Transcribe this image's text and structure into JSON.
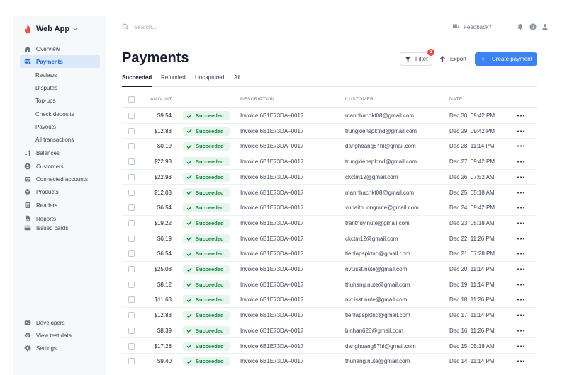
{
  "app": {
    "name": "Web App"
  },
  "sidebar": {
    "top_items": [
      {
        "label": "Overview",
        "icon": "home-icon"
      },
      {
        "label": "Payments",
        "icon": "payments-icon",
        "active": true
      }
    ],
    "sub_items": [
      "Reviews",
      "Disputes",
      "Top-ups",
      "Check deposits",
      "Payouts",
      "All transactions"
    ],
    "items": [
      {
        "label": "Balances",
        "icon": "balances-icon"
      },
      {
        "label": "Customers",
        "icon": "customers-icon"
      },
      {
        "label": "Connected accounts",
        "icon": "connected-accounts-icon"
      },
      {
        "label": "Products",
        "icon": "products-icon"
      },
      {
        "label": "Readers",
        "icon": "readers-icon"
      },
      {
        "label": "Reports",
        "icon": "reports-icon"
      },
      {
        "label": "Issued cards",
        "icon": "issued-cards-icon"
      }
    ],
    "bottom_items": [
      {
        "label": "Developers",
        "icon": "developers-icon"
      },
      {
        "label": "View test data",
        "icon": "eye-icon"
      },
      {
        "label": "Settings",
        "icon": "gear-icon"
      }
    ]
  },
  "topbar": {
    "search_placeholder": "Search...",
    "feedback_label": "Feedback?"
  },
  "header": {
    "title": "Payments",
    "filter_label": "Filter",
    "filter_badge": "1",
    "export_label": "Export",
    "create_label": "Create payment"
  },
  "tabs": [
    "Succeeded",
    "Refunded",
    "Uncaptured",
    "All"
  ],
  "table": {
    "columns": [
      "AMOUNT",
      "DESCRIPTION",
      "CUSTOMER",
      "DATE"
    ],
    "status_label": "Succeeded",
    "rows": [
      {
        "amount": "$9.54",
        "description": "Invoice 6B1E73DA–0017",
        "customer": "manhhachkt08@gmail.com",
        "date": "Dec 30, 09:42 PM"
      },
      {
        "amount": "$12.83",
        "description": "Invoice 6B1E73DA–0017",
        "customer": "trungkienspktnd@gmail.com",
        "date": "Dec 29, 09:42 PM"
      },
      {
        "amount": "$0.19",
        "description": "Invoice 6B1E73DA–0017",
        "customer": "danghoang87hl@gmail.com",
        "date": "Dec 28, 11:14 PM"
      },
      {
        "amount": "$22.93",
        "description": "Invoice 6B1E73DA–0017",
        "customer": "trungkienspktnd@gmail.com",
        "date": "Dec 27, 09:42 PM"
      },
      {
        "amount": "$22.93",
        "description": "Invoice 6B1E73DA–0017",
        "customer": "ckctm12@gmail.com",
        "date": "Dec 26, 07:52 AM"
      },
      {
        "amount": "$12.03",
        "description": "Invoice 6B1E73DA–0017",
        "customer": "manhhachkt08@gmail.com",
        "date": "Dec 25, 05:18 AM"
      },
      {
        "amount": "$6.54",
        "description": "Invoice 6B1E73DA–0017",
        "customer": "vuhaithuongnute@gmail.com",
        "date": "Dec 24, 09:42 PM"
      },
      {
        "amount": "$19.22",
        "description": "Invoice 6B1E73DA–0017",
        "customer": "tranthuy.nute@gmail.com",
        "date": "Dec 23, 05:18 AM"
      },
      {
        "amount": "$6.19",
        "description": "Invoice 6B1E73DA–0017",
        "customer": "ckctm12@gmail.com",
        "date": "Dec 22, 11:26 PM"
      },
      {
        "amount": "$6.54",
        "description": "Invoice 6B1E73DA–0017",
        "customer": "tienlapspktnd@gmail.com",
        "date": "Dec 21, 07:28 PM"
      },
      {
        "amount": "$25.08",
        "description": "Invoice 6B1E73DA–0017",
        "customer": "nvt.isst.nute@gmail.com",
        "date": "Dec 20, 11:14 PM"
      },
      {
        "amount": "$8.12",
        "description": "Invoice 6B1E73DA–0017",
        "customer": "thuhang.nute@gmail.com",
        "date": "Dec 19, 11:14 PM"
      },
      {
        "amount": "$11.63",
        "description": "Invoice 6B1E73DA–0017",
        "customer": "nvt.isst.nute@gmail.com",
        "date": "Dec 18, 11:26 PM"
      },
      {
        "amount": "$12.83",
        "description": "Invoice 6B1E73DA–0017",
        "customer": "tienlapspktnd@gmail.com",
        "date": "Dec 17, 11:14 PM"
      },
      {
        "amount": "$8.39",
        "description": "Invoice 6B1E73DA–0017",
        "customer": "binhan628@gmail.com",
        "date": "Dec 16, 11:26 PM"
      },
      {
        "amount": "$17.28",
        "description": "Invoice 6B1E73DA–0017",
        "customer": "danghoang87hl@gmail.com",
        "date": "Dec 15, 05:18 AM"
      },
      {
        "amount": "$9.40",
        "description": "Invoice 6B1E73DA–0017",
        "customer": "thuhang.nute@gmail.com",
        "date": "Dec 14, 11:14 PM"
      }
    ]
  },
  "colors": {
    "accent": "#3b82f6",
    "active_nav_bg": "#dbe9fb",
    "success_bg": "#e6f6ec",
    "success_text": "#0e8a3c",
    "badge": "#ef4444"
  }
}
